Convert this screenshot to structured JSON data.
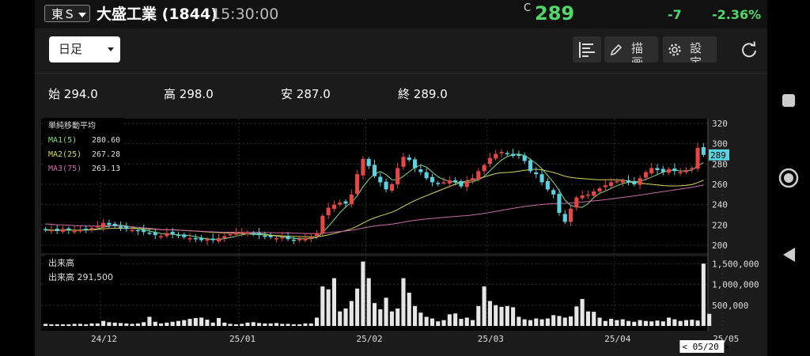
{
  "header": {
    "market_label": "東Ｓ",
    "company_name": "大盛工業",
    "code": "(1844)",
    "time": "15:30:00",
    "price_flag": "C",
    "price": "289",
    "change": "-7",
    "change_pct": "-2.36%"
  },
  "toolbar": {
    "period_select": "日足",
    "draw_label": "描画",
    "settings_label": "設定"
  },
  "ohlc": [
    {
      "label": "始",
      "value": "294.0"
    },
    {
      "label": "高",
      "value": "298.0"
    },
    {
      "label": "安",
      "value": "287.0"
    },
    {
      "label": "終",
      "value": "289.0"
    }
  ],
  "legend": {
    "title": "単純移動平均",
    "ma": [
      {
        "name": "MA1(5)",
        "value": "280.60",
        "color": "#7fdc8a"
      },
      {
        "name": "MA2(25)",
        "value": "267.28",
        "color": "#d8d85a"
      },
      {
        "name": "MA3(75)",
        "value": "263.13",
        "color": "#c86aa8"
      }
    ]
  },
  "volume_legend": {
    "title": "出来高",
    "label": "出来高",
    "value": "291,500"
  },
  "colors": {
    "up": "#e64646",
    "down": "#5ad2e0",
    "price_green": "#52d86a",
    "volume": "#e6e6e6"
  },
  "chart_data": [
    {
      "type": "candlestick",
      "title": "",
      "ylim": [
        200,
        320
      ],
      "y_ticks": [
        "320",
        "300",
        "280",
        "260",
        "240",
        "220",
        "200"
      ],
      "x_tick_labels": [
        "24/12",
        "25/01",
        "25/02",
        "25/03",
        "25/04",
        "25/05"
      ],
      "current_price_label": "289",
      "cursor_date_label": "< 05/20 >",
      "moving_averages": [
        {
          "name": "MA1(5)",
          "last": 280.6
        },
        {
          "name": "MA2(25)",
          "last": 267.28
        },
        {
          "name": "MA3(75)",
          "last": 263.13
        }
      ],
      "closes": [
        215,
        215,
        214,
        216,
        215,
        214,
        215,
        216,
        217,
        219,
        222,
        220,
        219,
        218,
        216,
        215,
        214,
        213,
        212,
        210,
        209,
        212,
        211,
        210,
        208,
        207,
        206,
        205,
        206,
        205,
        207,
        209,
        211,
        212,
        213,
        212,
        211,
        210,
        209,
        208,
        207,
        208,
        206,
        205,
        206,
        207,
        208,
        212,
        229,
        237,
        240,
        242,
        241,
        250,
        270,
        285,
        278,
        268,
        262,
        255,
        260,
        276,
        287,
        284,
        276,
        272,
        266,
        262,
        261,
        262,
        264,
        262,
        258,
        263,
        266,
        273,
        279,
        286,
        290,
        292,
        290,
        288,
        289,
        283,
        273,
        270,
        262,
        255,
        250,
        232,
        223,
        236,
        247,
        249,
        250,
        253,
        256,
        259,
        262,
        263,
        264,
        262,
        260,
        266,
        272,
        276,
        274,
        272,
        275,
        273,
        272,
        274,
        276,
        296,
        289
      ]
    },
    {
      "type": "bar",
      "title": "",
      "ylim": [
        0,
        1600000
      ],
      "y_ticks": [
        "1,500,000",
        "1,000,000",
        "500,000",
        "0"
      ],
      "last_value": 291500,
      "values": [
        50000,
        40000,
        40000,
        40000,
        40000,
        50000,
        50000,
        40000,
        60000,
        60000,
        120000,
        90000,
        80000,
        70000,
        60000,
        50000,
        60000,
        90000,
        220000,
        100000,
        60000,
        80000,
        100000,
        120000,
        140000,
        170000,
        190000,
        200000,
        150000,
        80000,
        190000,
        80000,
        50000,
        40000,
        50000,
        80000,
        90000,
        70000,
        60000,
        60000,
        70000,
        50000,
        50000,
        40000,
        40000,
        60000,
        60000,
        200000,
        950000,
        880000,
        1150000,
        350000,
        420000,
        600000,
        900000,
        1550000,
        1150000,
        550000,
        400000,
        680000,
        350000,
        420000,
        1150000,
        800000,
        480000,
        320000,
        220000,
        180000,
        110000,
        140000,
        280000,
        300000,
        170000,
        200000,
        140000,
        480000,
        950000,
        600000,
        500000,
        460000,
        480000,
        450000,
        220000,
        160000,
        140000,
        180000,
        160000,
        180000,
        260000,
        240000,
        200000,
        230000,
        470000,
        650000,
        350000,
        340000,
        200000,
        120000,
        170000,
        140000,
        160000,
        120000,
        100000,
        140000,
        120000,
        110000,
        130000,
        110000,
        200000,
        160000,
        120000,
        140000,
        150000,
        130000,
        1500000,
        291500
      ]
    }
  ]
}
